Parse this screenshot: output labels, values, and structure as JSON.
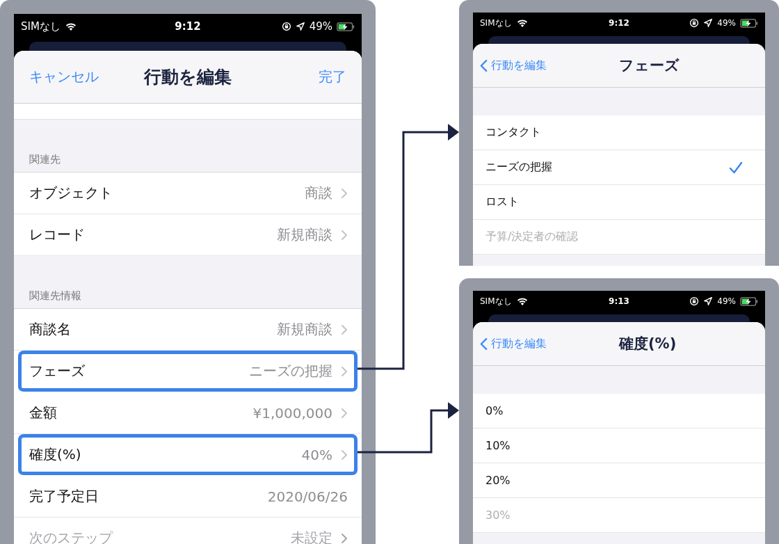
{
  "screens": [
    {
      "kind": "editor",
      "status_bar": {
        "carrier": "SIMなし",
        "time": "9:12",
        "battery": "49%"
      },
      "nav": {
        "cancel": "キャンセル",
        "title": "行動を編集",
        "done": "完了"
      },
      "sections": [
        {
          "header": "関連先",
          "rows": [
            {
              "label": "オブジェクト",
              "value": "商談",
              "chevron": true,
              "highlighted": false,
              "faded": false
            },
            {
              "label": "レコード",
              "value": "新規商談",
              "chevron": true,
              "highlighted": false,
              "faded": false
            }
          ]
        },
        {
          "header": "関連先情報",
          "rows": [
            {
              "label": "商談名",
              "value": "新規商談",
              "chevron": true,
              "highlighted": false,
              "faded": false
            },
            {
              "label": "フェーズ",
              "value": "ニーズの把握",
              "chevron": true,
              "highlighted": true,
              "faded": false
            },
            {
              "label": "金額",
              "value": "¥1,000,000",
              "chevron": true,
              "highlighted": false,
              "faded": false
            },
            {
              "label": "確度(%)",
              "value": "40%",
              "chevron": true,
              "highlighted": true,
              "faded": false
            },
            {
              "label": "完了予定日",
              "value": "2020/06/26",
              "chevron": false,
              "highlighted": false,
              "faded": false
            },
            {
              "label": "次のステップ",
              "value": "未設定",
              "chevron": true,
              "highlighted": false,
              "faded": true
            }
          ]
        }
      ]
    },
    {
      "kind": "picker",
      "status_bar": {
        "carrier": "SIMなし",
        "time": "9:12",
        "battery": "49%"
      },
      "nav": {
        "back": "行動を編集",
        "title": "フェーズ"
      },
      "options": [
        {
          "label": "コンタクト",
          "selected": false,
          "faded": false
        },
        {
          "label": "ニーズの把握",
          "selected": true,
          "faded": false
        },
        {
          "label": "ロスト",
          "selected": false,
          "faded": false
        },
        {
          "label": "予算/決定者の確認",
          "selected": false,
          "faded": true
        }
      ]
    },
    {
      "kind": "picker",
      "status_bar": {
        "carrier": "SIMなし",
        "time": "9:13",
        "battery": "49%"
      },
      "nav": {
        "back": "行動を編集",
        "title": "確度(%)"
      },
      "options": [
        {
          "label": "0%",
          "selected": false,
          "faded": false
        },
        {
          "label": "10%",
          "selected": false,
          "faded": false
        },
        {
          "label": "20%",
          "selected": false,
          "faded": false
        },
        {
          "label": "30%",
          "selected": false,
          "faded": true
        }
      ]
    }
  ]
}
